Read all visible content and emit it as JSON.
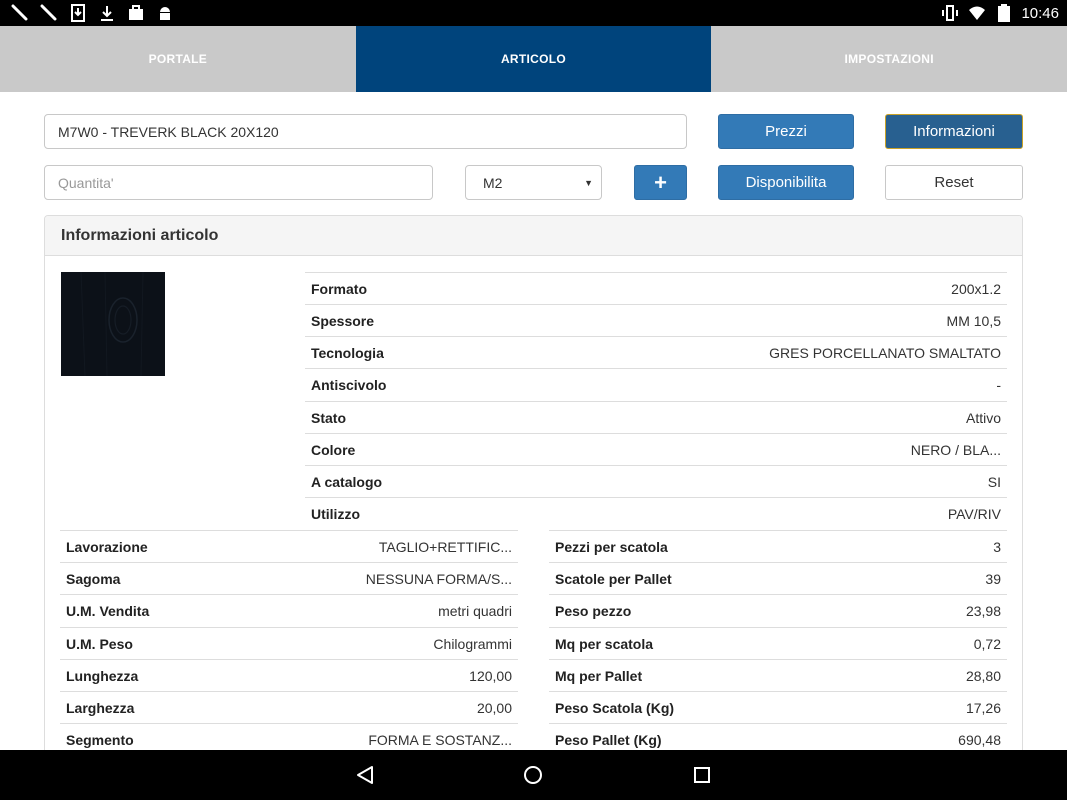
{
  "status_bar": {
    "time": "10:46",
    "left_icons": [
      "tool-icon",
      "tool-icon",
      "download-box-icon",
      "download-icon",
      "briefcase-icon",
      "android-icon"
    ],
    "right_icons": [
      "vibrate-icon",
      "wifi-icon",
      "battery-icon"
    ]
  },
  "tabs": [
    {
      "label": "PORTALE",
      "active": false
    },
    {
      "label": "ARTICOLO",
      "active": true
    },
    {
      "label": "IMPOSTAZIONI",
      "active": false
    }
  ],
  "form": {
    "article_value": "M7W0 - TREVERK BLACK    20X120",
    "quantity_placeholder": "Quantita'",
    "unit_selected": "M2"
  },
  "buttons": {
    "prezzi": "Prezzi",
    "informazioni": "Informazioni",
    "disponibilita": "Disponibilita",
    "reset": "Reset",
    "add": "+"
  },
  "panel": {
    "title": "Informazioni articolo",
    "top_rows": [
      {
        "k": "Formato",
        "v": "200x1.2"
      },
      {
        "k": "Spessore",
        "v": "MM 10,5"
      },
      {
        "k": "Tecnologia",
        "v": "GRES PORCELLANATO SMALTATO"
      },
      {
        "k": "Antiscivolo",
        "v": "-"
      },
      {
        "k": "Stato",
        "v": "Attivo"
      },
      {
        "k": "Colore",
        "v": "NERO / BLA..."
      },
      {
        "k": "A catalogo",
        "v": "SI"
      },
      {
        "k": "Utilizzo",
        "v": "PAV/RIV"
      }
    ],
    "left_rows": [
      {
        "k": "Lavorazione",
        "v": "TAGLIO+RETTIFIC..."
      },
      {
        "k": "Sagoma",
        "v": "NESSUNA FORMA/S..."
      },
      {
        "k": "U.M. Vendita",
        "v": "metri quadri"
      },
      {
        "k": "U.M. Peso",
        "v": "Chilogrammi"
      },
      {
        "k": "Lunghezza",
        "v": "120,00"
      },
      {
        "k": "Larghezza",
        "v": "20,00"
      },
      {
        "k": "Segmento",
        "v": "FORMA E SOSTANZ..."
      }
    ],
    "right_rows": [
      {
        "k": "Pezzi per scatola",
        "v": "3"
      },
      {
        "k": "Scatole per Pallet",
        "v": "39"
      },
      {
        "k": "Peso pezzo",
        "v": "23,98"
      },
      {
        "k": "Mq per scatola",
        "v": "0,72"
      },
      {
        "k": "Mq per Pallet",
        "v": "28,80"
      },
      {
        "k": "Peso Scatola (Kg)",
        "v": "17,26"
      },
      {
        "k": "Peso Pallet (Kg)",
        "v": "690,48"
      }
    ]
  },
  "colors": {
    "active_tab": "#00447c",
    "inactive_tab": "#c9c9c9",
    "primary_button": "#337ab7"
  }
}
